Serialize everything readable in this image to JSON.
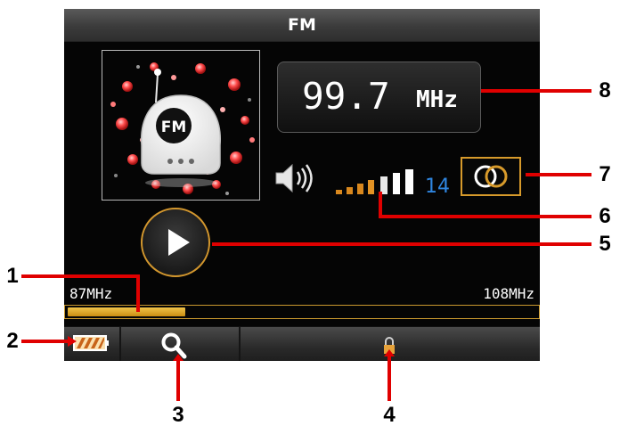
{
  "screen": {
    "title": "FM",
    "album_art": {
      "icon": "fm-radio-robot-icon",
      "badge": "FM"
    },
    "frequency": {
      "value": "99.7",
      "unit": "MHz"
    },
    "volume": {
      "icon": "speaker-icon",
      "level": 14,
      "bars_total": 7,
      "bar_colors": [
        "#d9881e",
        "#ffffff"
      ]
    },
    "stereo_toggle": {
      "icon": "stereo-rings-icon",
      "accent": "#d79a2b"
    },
    "play_button": {
      "icon": "play-icon",
      "accent": "#d3972e"
    },
    "band": {
      "min_label": "87MHz",
      "max_label": "108MHz",
      "position_fraction": 0.25
    },
    "bottom_bar": {
      "battery": {
        "icon": "battery-icon"
      },
      "search": {
        "icon": "search-icon"
      },
      "lock": {
        "icon": "lock-icon"
      }
    }
  },
  "callouts": [
    "1",
    "2",
    "3",
    "4",
    "5",
    "6",
    "7",
    "8"
  ],
  "colors": {
    "callout_line": "#e00000",
    "text": "#ffffff",
    "volume_number": "#2f86e0"
  }
}
